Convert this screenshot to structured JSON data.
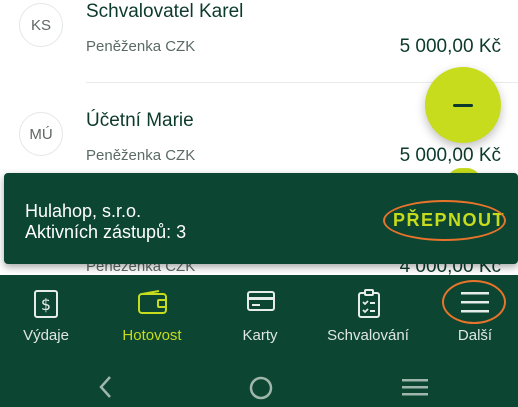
{
  "colors": {
    "brand_dark": "#0c4531",
    "accent": "#c6dc1d",
    "highlight": "#e8742c",
    "text_dark": "#0c3a2c"
  },
  "list": {
    "rows": [
      {
        "initials": "KS",
        "name": "Schvalovatel Karel",
        "wallet": "Peněženka CZK",
        "amount": "5 000,00 Kč"
      },
      {
        "initials": "MÚ",
        "name": "Účetní Marie",
        "wallet": "Peněženka CZK",
        "amount": "5 000,00 Kč"
      },
      {
        "initials": "",
        "name": "",
        "wallet": "Peněženka CZK",
        "amount": "4 000,00 Kč"
      }
    ]
  },
  "fab": {
    "icon": "minus-icon"
  },
  "snackbar": {
    "line1": "Hulahop, s.r.o.",
    "line2": "Aktivních zástupů: 3",
    "action": "PŘEPNOUT"
  },
  "bottom_nav": {
    "active": "Hotovost",
    "items": [
      {
        "label": "Výdaje",
        "icon": "receipt-dollar-icon"
      },
      {
        "label": "Hotovost",
        "icon": "wallet-icon"
      },
      {
        "label": "Karty",
        "icon": "card-icon"
      },
      {
        "label": "Schvalování",
        "icon": "clipboard-check-icon"
      },
      {
        "label": "Další",
        "icon": "menu-icon"
      }
    ]
  },
  "system_nav": {
    "icons": [
      "back-icon",
      "home-icon",
      "recents-icon"
    ]
  }
}
